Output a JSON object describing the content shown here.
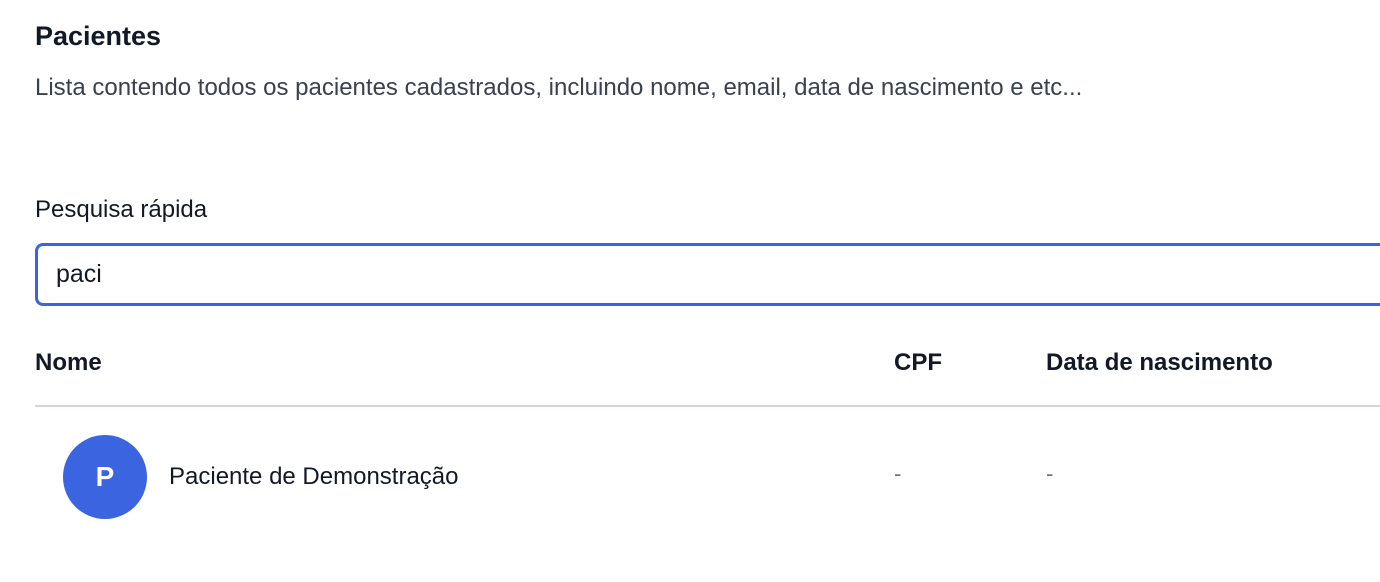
{
  "header": {
    "title": "Pacientes",
    "subtitle": "Lista contendo todos os pacientes cadastrados, incluindo nome, email, data de nascimento e etc..."
  },
  "search": {
    "label": "Pesquisa rápida",
    "value": "paci"
  },
  "table": {
    "columns": [
      "Nome",
      "CPF",
      "Data de nascimento"
    ],
    "rows": [
      {
        "avatar_initial": "P",
        "nome": "Paciente de Demonstração",
        "cpf": "-",
        "data_nascimento": "-"
      }
    ]
  },
  "colors": {
    "accent": "#3b64e0",
    "divider": "#d1d5db",
    "text": "#111827",
    "muted": "#6b7280"
  }
}
